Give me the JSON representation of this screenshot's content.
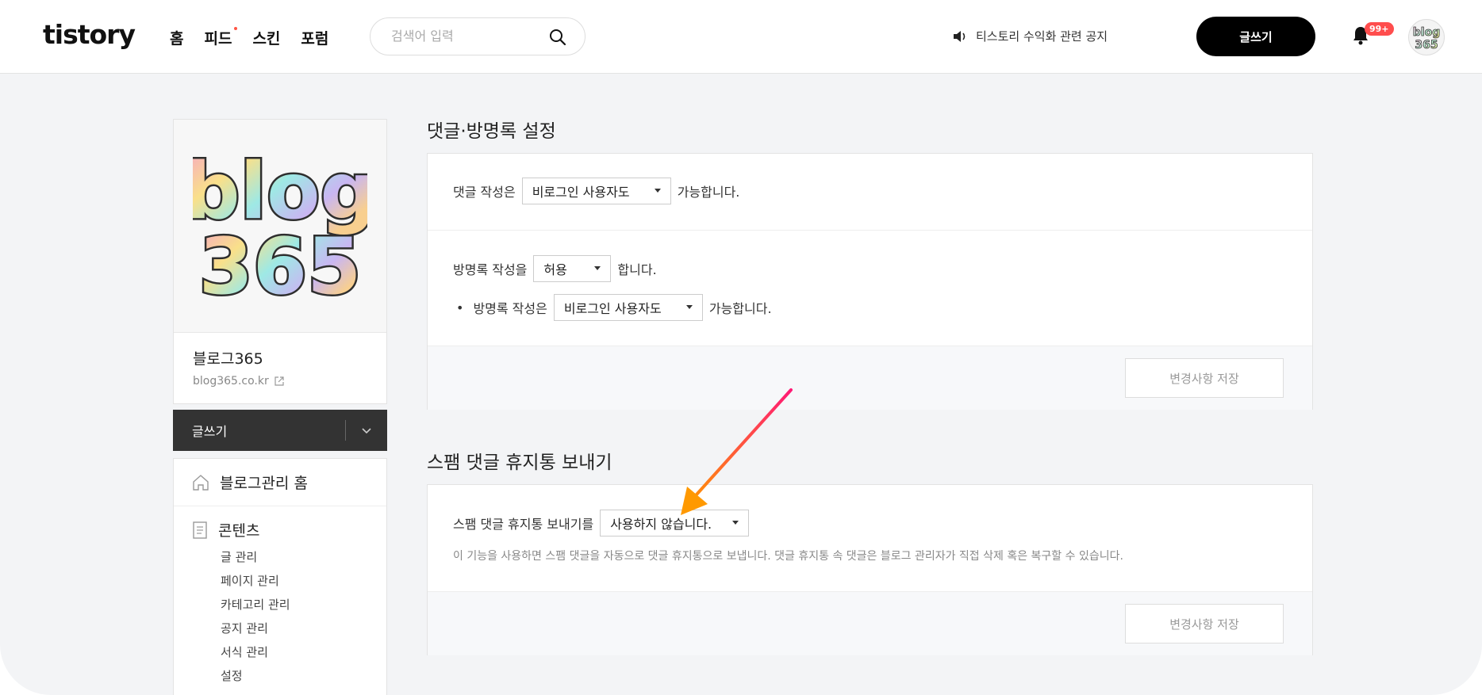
{
  "header": {
    "logo": "tistory",
    "nav": [
      "홈",
      "피드",
      "스킨",
      "포럼"
    ],
    "search_placeholder": "검색어 입력",
    "notice": "티스토리 수익화 관련 공지",
    "write_label": "글쓰기",
    "badge": "99+",
    "avatar_text": "blog 365"
  },
  "sidebar": {
    "logo_text_top": "blog",
    "logo_text_bottom": "365",
    "blog_name": "블로그365",
    "blog_url": "blog365.co.kr",
    "write_label": "글쓰기",
    "home_label": "블로그관리 홈",
    "content_label": "콘텐츠",
    "content_items": [
      "글 관리",
      "페이지 관리",
      "카테고리 관리",
      "공지 관리",
      "서식 관리",
      "설정"
    ]
  },
  "comments": {
    "title": "댓글·방명록 설정",
    "comment_prefix": "댓글 작성은",
    "comment_value": "비로그인 사용자도",
    "comment_suffix": "가능합니다.",
    "guestbook_prefix": "방명록 작성을",
    "guestbook_value": "허용",
    "guestbook_suffix": "합니다.",
    "bullet": "•",
    "guestbook_write_prefix": "방명록 작성은",
    "guestbook_write_value": "비로그인 사용자도",
    "guestbook_write_suffix": "가능합니다.",
    "save_label": "변경사항 저장"
  },
  "spam": {
    "title": "스팸 댓글 휴지통 보내기",
    "prefix": "스팸 댓글 휴지통 보내기를",
    "value": "사용하지 않습니다.",
    "description": "이 기능을 사용하면 스팸 댓글을 자동으로 댓글 휴지통으로 보냅니다. 댓글 휴지통 속 댓글은 블로그 관리자가 직접 삭제 혹은 복구할 수 있습니다.",
    "save_label": "변경사항 저장"
  },
  "colors": {
    "accent_dot": "#ff5544",
    "badge": "#ff4d4d",
    "arrow_start": "#ff1a75",
    "arrow_end": "#ff9900"
  }
}
